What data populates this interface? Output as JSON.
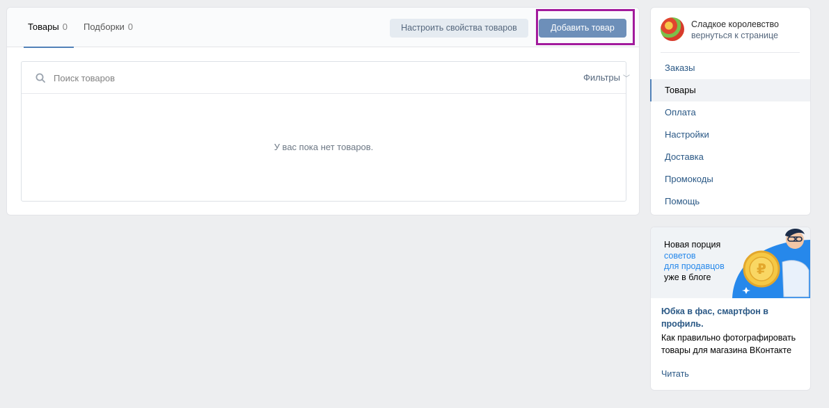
{
  "tabs": [
    {
      "label": "Товары",
      "count": "0"
    },
    {
      "label": "Подборки",
      "count": "0"
    }
  ],
  "toolbar": {
    "configure_label": "Настроить свойства товаров",
    "add_label": "Добавить товар"
  },
  "search": {
    "placeholder": "Поиск товаров",
    "value": "",
    "filters_label": "Фильтры"
  },
  "empty_state": "У вас пока нет товаров.",
  "sidebar": {
    "store_name": "Сладкое королевство",
    "back_link": "вернуться к странице",
    "items": [
      {
        "label": "Заказы"
      },
      {
        "label": "Товары"
      },
      {
        "label": "Оплата"
      },
      {
        "label": "Настройки"
      },
      {
        "label": "Доставка"
      },
      {
        "label": "Промокоды"
      },
      {
        "label": "Помощь"
      }
    ],
    "active_item": "Товары"
  },
  "promo": {
    "banner_line1": "Новая порция",
    "banner_line2": "советов",
    "banner_line3": "для продавцов",
    "banner_line4": "уже в блоге",
    "title": "Юбка в фас, смартфон в профиль.",
    "description": "Как правильно фотографировать товары для магазина ВКонтакте",
    "link": "Читать"
  },
  "colors": {
    "accent": "#5181b8",
    "primary_button": "#6d8fb9",
    "highlight": "#a21a9c",
    "link": "#2a5885",
    "blue_banner": "#2688eb"
  }
}
